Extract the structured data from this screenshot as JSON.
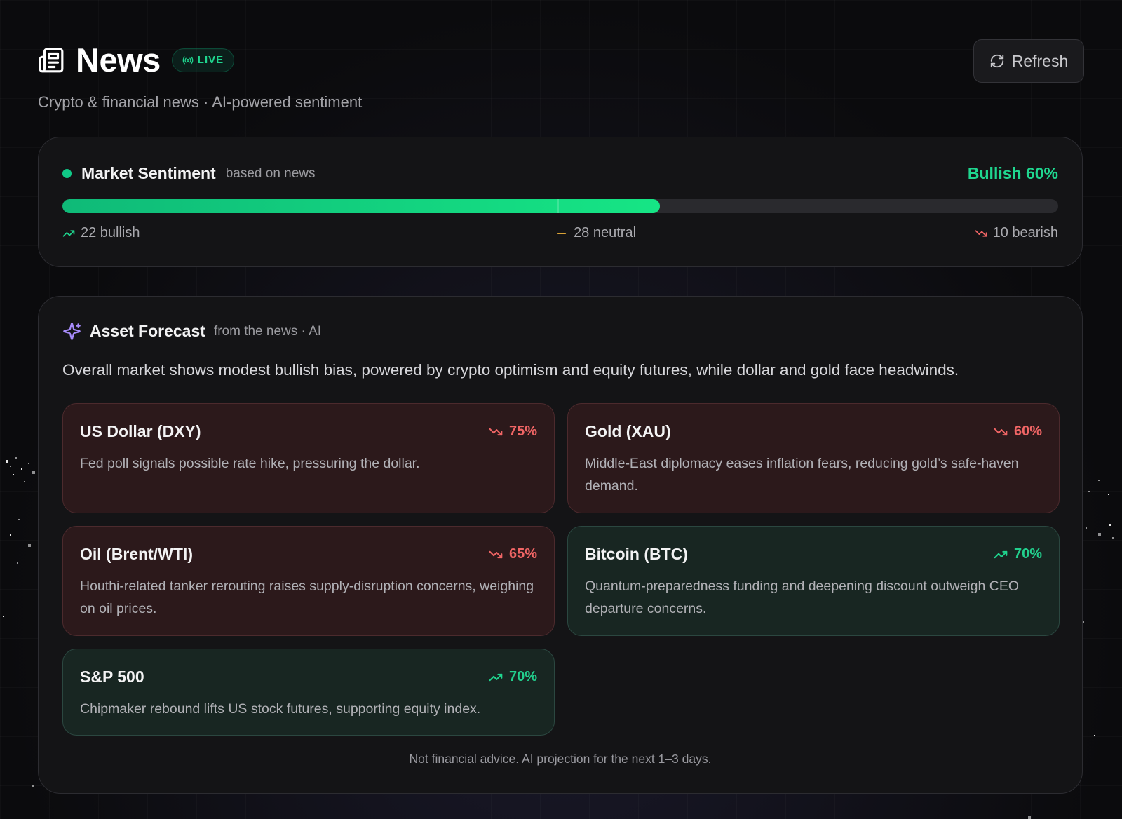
{
  "header": {
    "title": "News",
    "live_label": "LIVE",
    "subtitle": "Crypto & financial news · AI-powered sentiment",
    "refresh_label": "Refresh"
  },
  "sentiment": {
    "title": "Market Sentiment",
    "subtitle": "based on news",
    "value_label": "Bullish 60%",
    "bullish_fraction": 0.6,
    "bullish_count": "22 bullish",
    "neutral_count": "28 neutral",
    "bearish_count": "10 bearish",
    "colors": {
      "bullish": "#1fd68f",
      "neutral": "#f5b73b",
      "bearish": "#f06565"
    }
  },
  "forecast": {
    "title": "Asset Forecast",
    "subtitle": "from the news · AI",
    "summary": "Overall market shows modest bullish bias, powered by crypto optimism and equity futures, while dollar and gold face headwinds.",
    "assets": [
      {
        "name": "US Dollar (DXY)",
        "direction": "bearish",
        "pct": "75%",
        "description": "Fed poll signals possible rate hike, pressuring the dollar."
      },
      {
        "name": "Gold (XAU)",
        "direction": "bearish",
        "pct": "60%",
        "description": "Middle-East diplomacy eases inflation fears, reducing gold’s safe-haven demand."
      },
      {
        "name": "Oil (Brent/WTI)",
        "direction": "bearish",
        "pct": "65%",
        "description": "Houthi-related tanker rerouting raises supply-disruption concerns, weighing on oil prices."
      },
      {
        "name": "Bitcoin (BTC)",
        "direction": "bullish",
        "pct": "70%",
        "description": "Quantum-preparedness funding and deepening discount outweigh CEO departure concerns."
      },
      {
        "name": "S&P 500",
        "direction": "bullish",
        "pct": "70%",
        "description": "Chipmaker rebound lifts US stock futures, supporting equity index."
      }
    ],
    "disclaimer": "Not financial advice. AI projection for the next 1–3 days."
  }
}
